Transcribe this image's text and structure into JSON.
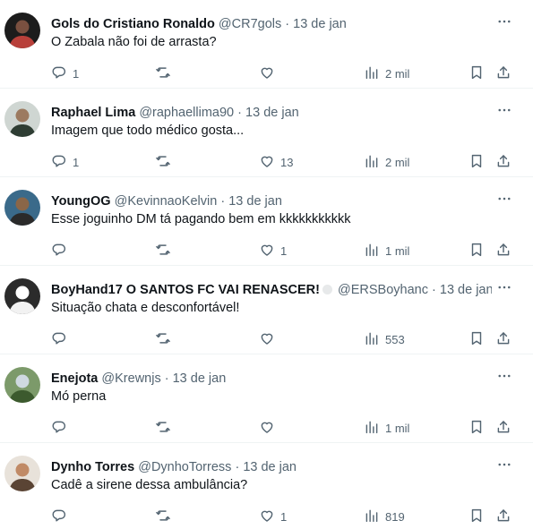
{
  "tweets": [
    {
      "name": "Gols do Cristiano Ronaldo",
      "verified": false,
      "handle": "@CR7gols",
      "sep": "·",
      "date": "13 de jan",
      "text": "O Zabala não foi de arrasta?",
      "replies": "1",
      "retweets": "",
      "likes": "",
      "views": "2 mil",
      "avatar": {
        "bg": "#1c1c1c",
        "fg": "#b8403a",
        "skin": "#7a5040"
      }
    },
    {
      "name": "Raphael Lima",
      "verified": false,
      "handle": "@raphaellima90",
      "sep": "·",
      "date": "13 de jan",
      "text": "Imagem que todo médico gosta...",
      "replies": "1",
      "retweets": "",
      "likes": "13",
      "views": "2 mil",
      "avatar": {
        "bg": "#cfd6d2",
        "fg": "#2e3d33",
        "skin": "#9c7a60"
      }
    },
    {
      "name": "YoungOG",
      "verified": false,
      "handle": "@KevinnaoKelvin",
      "sep": "·",
      "date": "13 de jan",
      "text": "Esse joguinho DM tá pagando bem em kkkkkkkkkkk",
      "replies": "",
      "retweets": "",
      "likes": "1",
      "views": "1 mil",
      "avatar": {
        "bg": "#3a6a8a",
        "fg": "#2a2a2a",
        "skin": "#8a6648"
      }
    },
    {
      "name": "BoyHand17 O SANTOS FC VAI RENASCER!",
      "verified": true,
      "handle": "@ERSBoyhanc",
      "sep": "·",
      "date": "13 de jan",
      "text": "Situação chata e desconfortável!",
      "replies": "",
      "retweets": "",
      "likes": "",
      "views": "553",
      "avatar": {
        "bg": "#2b2b2b",
        "fg": "#f2f2f2",
        "skin": "#ffffff"
      }
    },
    {
      "name": "Enejota",
      "verified": false,
      "handle": "@Krewnjs",
      "sep": "·",
      "date": "13 de jan",
      "text": "Mó perna",
      "replies": "",
      "retweets": "",
      "likes": "",
      "views": "1 mil",
      "avatar": {
        "bg": "#7c9a6a",
        "fg": "#3c5a2e",
        "skin": "#cfd9e0"
      }
    },
    {
      "name": "Dynho Torres",
      "verified": false,
      "handle": "@DynhoTorress",
      "sep": "·",
      "date": "13 de jan",
      "text": "Cadê a sirene dessa ambulância?",
      "replies": "",
      "retweets": "",
      "likes": "1",
      "views": "819",
      "avatar": {
        "bg": "#e8e2da",
        "fg": "#5a4434",
        "skin": "#c08a66"
      }
    }
  ],
  "icons": {
    "reply": "reply-icon",
    "retweet": "retweet-icon",
    "like": "like-icon",
    "views": "views-icon",
    "bookmark": "bookmark-icon",
    "share": "share-icon",
    "more": "more-icon"
  },
  "colors": {
    "text": "#0f1419",
    "muted": "#536471",
    "divider": "#eff3f4"
  }
}
